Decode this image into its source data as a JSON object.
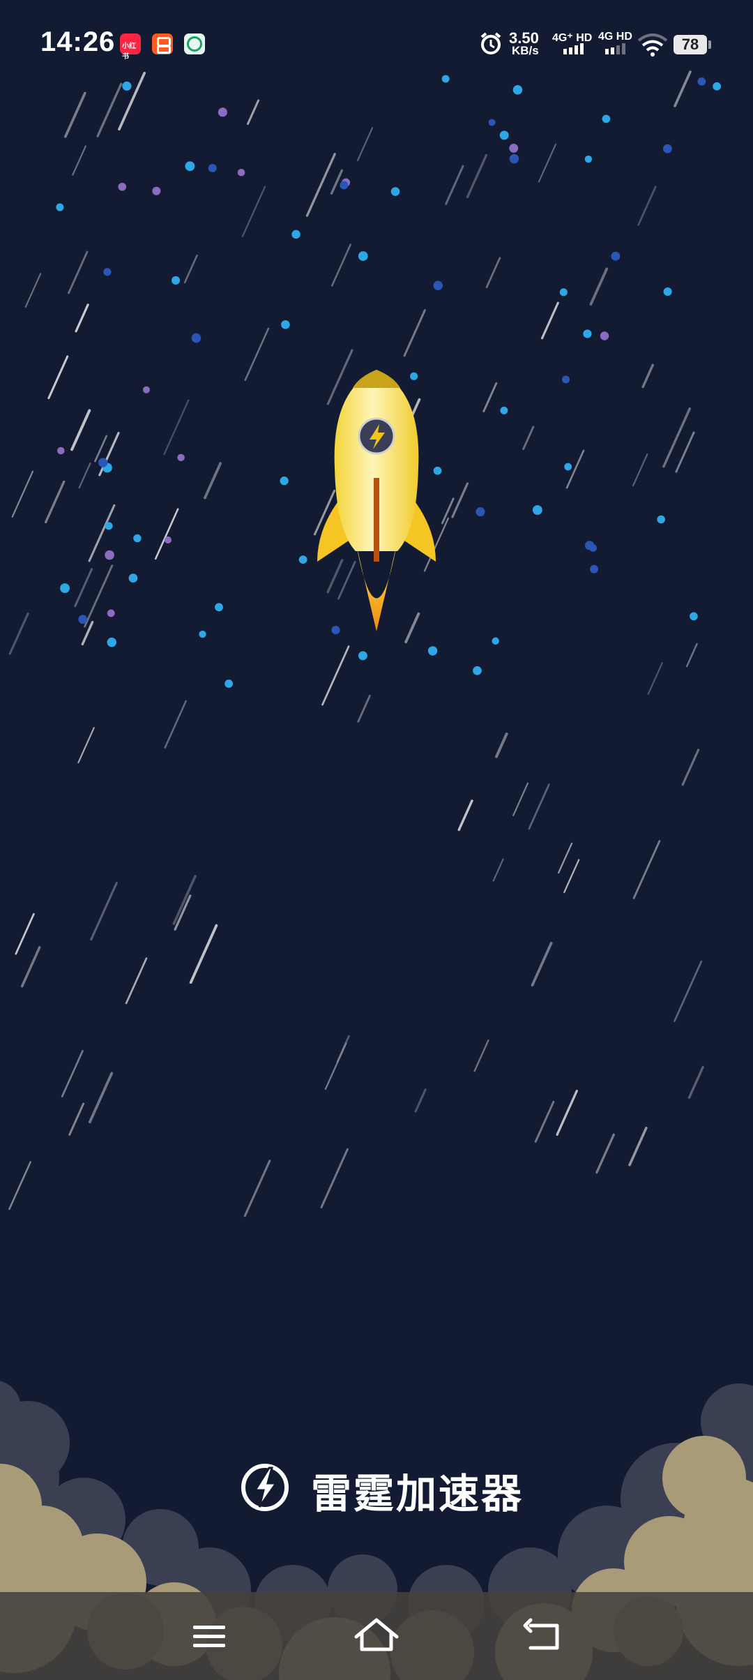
{
  "status_bar": {
    "time": "14:26",
    "notification_icons": [
      "xiaohongshu-app-icon",
      "orange-app-icon",
      "green-app-icon"
    ],
    "net_speed_value": "3.50",
    "net_speed_unit": "KB/s",
    "sim1_label": "4G⁺ HD",
    "sim2_label": "4G HD",
    "battery": "78"
  },
  "splash": {
    "app_name": "雷霆加速器"
  },
  "nav_bar": {
    "icons": [
      "menu-icon",
      "home-icon",
      "back-icon"
    ]
  },
  "colors": {
    "background": "#131b33",
    "rocket_body": "#f7dc4a",
    "rocket_flame": "#f08c12",
    "cloud_dark": "#3b3f52",
    "cloud_light": "#a99a78",
    "star_blue": "#2fa6e6",
    "star_purple": "#8c6cc0"
  }
}
